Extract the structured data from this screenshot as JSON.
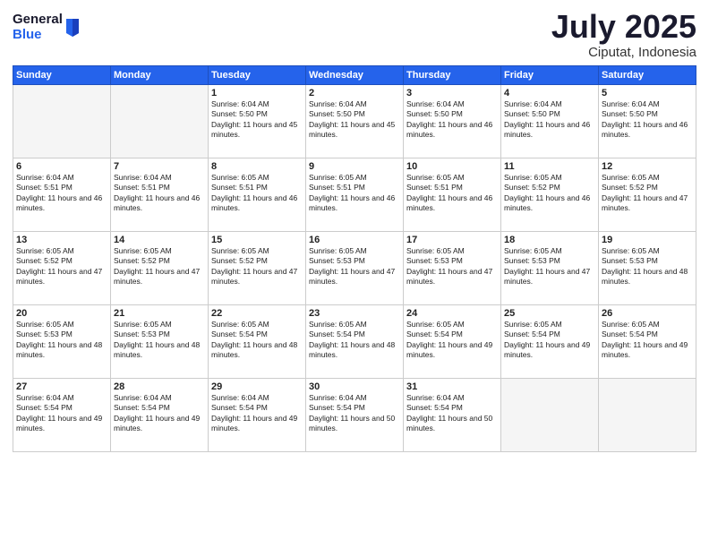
{
  "logo": {
    "general": "General",
    "blue": "Blue"
  },
  "header": {
    "month": "July 2025",
    "location": "Ciputat, Indonesia"
  },
  "weekdays": [
    "Sunday",
    "Monday",
    "Tuesday",
    "Wednesday",
    "Thursday",
    "Friday",
    "Saturday"
  ],
  "weeks": [
    [
      {
        "day": "",
        "sunrise": "",
        "sunset": "",
        "daylight": ""
      },
      {
        "day": "",
        "sunrise": "",
        "sunset": "",
        "daylight": ""
      },
      {
        "day": "1",
        "sunrise": "Sunrise: 6:04 AM",
        "sunset": "Sunset: 5:50 PM",
        "daylight": "Daylight: 11 hours and 45 minutes."
      },
      {
        "day": "2",
        "sunrise": "Sunrise: 6:04 AM",
        "sunset": "Sunset: 5:50 PM",
        "daylight": "Daylight: 11 hours and 45 minutes."
      },
      {
        "day": "3",
        "sunrise": "Sunrise: 6:04 AM",
        "sunset": "Sunset: 5:50 PM",
        "daylight": "Daylight: 11 hours and 46 minutes."
      },
      {
        "day": "4",
        "sunrise": "Sunrise: 6:04 AM",
        "sunset": "Sunset: 5:50 PM",
        "daylight": "Daylight: 11 hours and 46 minutes."
      },
      {
        "day": "5",
        "sunrise": "Sunrise: 6:04 AM",
        "sunset": "Sunset: 5:50 PM",
        "daylight": "Daylight: 11 hours and 46 minutes."
      }
    ],
    [
      {
        "day": "6",
        "sunrise": "Sunrise: 6:04 AM",
        "sunset": "Sunset: 5:51 PM",
        "daylight": "Daylight: 11 hours and 46 minutes."
      },
      {
        "day": "7",
        "sunrise": "Sunrise: 6:04 AM",
        "sunset": "Sunset: 5:51 PM",
        "daylight": "Daylight: 11 hours and 46 minutes."
      },
      {
        "day": "8",
        "sunrise": "Sunrise: 6:05 AM",
        "sunset": "Sunset: 5:51 PM",
        "daylight": "Daylight: 11 hours and 46 minutes."
      },
      {
        "day": "9",
        "sunrise": "Sunrise: 6:05 AM",
        "sunset": "Sunset: 5:51 PM",
        "daylight": "Daylight: 11 hours and 46 minutes."
      },
      {
        "day": "10",
        "sunrise": "Sunrise: 6:05 AM",
        "sunset": "Sunset: 5:51 PM",
        "daylight": "Daylight: 11 hours and 46 minutes."
      },
      {
        "day": "11",
        "sunrise": "Sunrise: 6:05 AM",
        "sunset": "Sunset: 5:52 PM",
        "daylight": "Daylight: 11 hours and 46 minutes."
      },
      {
        "day": "12",
        "sunrise": "Sunrise: 6:05 AM",
        "sunset": "Sunset: 5:52 PM",
        "daylight": "Daylight: 11 hours and 47 minutes."
      }
    ],
    [
      {
        "day": "13",
        "sunrise": "Sunrise: 6:05 AM",
        "sunset": "Sunset: 5:52 PM",
        "daylight": "Daylight: 11 hours and 47 minutes."
      },
      {
        "day": "14",
        "sunrise": "Sunrise: 6:05 AM",
        "sunset": "Sunset: 5:52 PM",
        "daylight": "Daylight: 11 hours and 47 minutes."
      },
      {
        "day": "15",
        "sunrise": "Sunrise: 6:05 AM",
        "sunset": "Sunset: 5:52 PM",
        "daylight": "Daylight: 11 hours and 47 minutes."
      },
      {
        "day": "16",
        "sunrise": "Sunrise: 6:05 AM",
        "sunset": "Sunset: 5:53 PM",
        "daylight": "Daylight: 11 hours and 47 minutes."
      },
      {
        "day": "17",
        "sunrise": "Sunrise: 6:05 AM",
        "sunset": "Sunset: 5:53 PM",
        "daylight": "Daylight: 11 hours and 47 minutes."
      },
      {
        "day": "18",
        "sunrise": "Sunrise: 6:05 AM",
        "sunset": "Sunset: 5:53 PM",
        "daylight": "Daylight: 11 hours and 47 minutes."
      },
      {
        "day": "19",
        "sunrise": "Sunrise: 6:05 AM",
        "sunset": "Sunset: 5:53 PM",
        "daylight": "Daylight: 11 hours and 48 minutes."
      }
    ],
    [
      {
        "day": "20",
        "sunrise": "Sunrise: 6:05 AM",
        "sunset": "Sunset: 5:53 PM",
        "daylight": "Daylight: 11 hours and 48 minutes."
      },
      {
        "day": "21",
        "sunrise": "Sunrise: 6:05 AM",
        "sunset": "Sunset: 5:53 PM",
        "daylight": "Daylight: 11 hours and 48 minutes."
      },
      {
        "day": "22",
        "sunrise": "Sunrise: 6:05 AM",
        "sunset": "Sunset: 5:54 PM",
        "daylight": "Daylight: 11 hours and 48 minutes."
      },
      {
        "day": "23",
        "sunrise": "Sunrise: 6:05 AM",
        "sunset": "Sunset: 5:54 PM",
        "daylight": "Daylight: 11 hours and 48 minutes."
      },
      {
        "day": "24",
        "sunrise": "Sunrise: 6:05 AM",
        "sunset": "Sunset: 5:54 PM",
        "daylight": "Daylight: 11 hours and 49 minutes."
      },
      {
        "day": "25",
        "sunrise": "Sunrise: 6:05 AM",
        "sunset": "Sunset: 5:54 PM",
        "daylight": "Daylight: 11 hours and 49 minutes."
      },
      {
        "day": "26",
        "sunrise": "Sunrise: 6:05 AM",
        "sunset": "Sunset: 5:54 PM",
        "daylight": "Daylight: 11 hours and 49 minutes."
      }
    ],
    [
      {
        "day": "27",
        "sunrise": "Sunrise: 6:04 AM",
        "sunset": "Sunset: 5:54 PM",
        "daylight": "Daylight: 11 hours and 49 minutes."
      },
      {
        "day": "28",
        "sunrise": "Sunrise: 6:04 AM",
        "sunset": "Sunset: 5:54 PM",
        "daylight": "Daylight: 11 hours and 49 minutes."
      },
      {
        "day": "29",
        "sunrise": "Sunrise: 6:04 AM",
        "sunset": "Sunset: 5:54 PM",
        "daylight": "Daylight: 11 hours and 49 minutes."
      },
      {
        "day": "30",
        "sunrise": "Sunrise: 6:04 AM",
        "sunset": "Sunset: 5:54 PM",
        "daylight": "Daylight: 11 hours and 50 minutes."
      },
      {
        "day": "31",
        "sunrise": "Sunrise: 6:04 AM",
        "sunset": "Sunset: 5:54 PM",
        "daylight": "Daylight: 11 hours and 50 minutes."
      },
      {
        "day": "",
        "sunrise": "",
        "sunset": "",
        "daylight": ""
      },
      {
        "day": "",
        "sunrise": "",
        "sunset": "",
        "daylight": ""
      }
    ]
  ]
}
